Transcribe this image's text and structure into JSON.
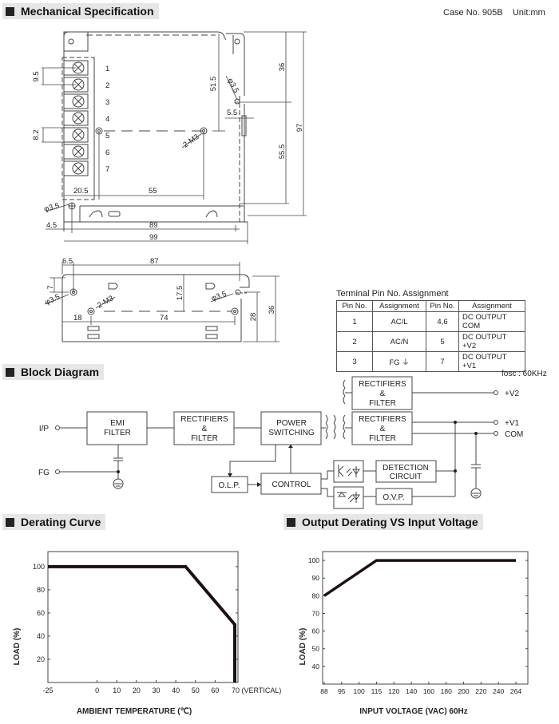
{
  "sections": {
    "mechanical": "Mechanical Specification",
    "block": "Block Diagram",
    "derating": "Derating Curve",
    "output_derating": "Output Derating VS Input Voltage"
  },
  "case_info": "Case No. 905B    Unit:mm",
  "mechanical": {
    "pin_numbers": [
      "1",
      "2",
      "3",
      "4",
      "5",
      "6",
      "7"
    ],
    "dims_top": {
      "d9_5": "9.5",
      "d8_2": "8.2",
      "d51_5": "51.5",
      "d3_5": "φ3.5",
      "d5_5": "5.5",
      "d36": "36",
      "d55_5": "55.5",
      "d97": "97",
      "m3": "2-M3",
      "d20_5": "20.5",
      "d55": "55",
      "d3_5b": "φ3.5",
      "d4_5": "4.5",
      "d89": "89",
      "d99": "99"
    },
    "dims_side": {
      "d6_5": "6.5",
      "d87": "87",
      "d7": "7",
      "d3_5": "φ3.5",
      "m3": "2-M3",
      "d17_5": "17.5",
      "d3_5r": "φ3.5",
      "d18": "18",
      "d74": "74",
      "d28": "28",
      "d36": "36"
    }
  },
  "pin_table": {
    "title": "Terminal Pin No.  Assignment",
    "headers": [
      "Pin No.",
      "Assignment",
      "Pin No.",
      "Assignment"
    ],
    "rows": [
      [
        "1",
        "AC/L",
        "4,6",
        "DC OUTPUT COM"
      ],
      [
        "2",
        "AC/N",
        "5",
        "DC OUTPUT +V2"
      ],
      [
        "3",
        "FG ⏚",
        "7",
        "DC OUTPUT +V1"
      ]
    ]
  },
  "block_diagram": {
    "fosc": "fosc : 60KHz",
    "ip": "I/P",
    "fg": "FG",
    "emi1": "EMI",
    "emi2": "FILTER",
    "rect_a1": "RECTIFIERS",
    "rect_a2": "&",
    "rect_a3": "FILTER",
    "pwr1": "POWER",
    "pwr2": "SWITCHING",
    "rect_b1": "RECTIFIERS",
    "rect_b2": "&",
    "rect_b3": "FILTER",
    "rect_c1": "RECTIFIERS",
    "rect_c2": "&",
    "rect_c3": "FILTER",
    "v2": "+V2",
    "v1": "+V1",
    "com": "COM",
    "olp": "O.L.P.",
    "control": "CONTROL",
    "det1": "DETECTION",
    "det2": "CIRCUIT",
    "ovp": "O.V.P."
  },
  "chart_data": [
    {
      "type": "line",
      "title": "Derating Curve",
      "xlabel": "AMBIENT TEMPERATURE (℃)",
      "ylabel": "LOAD (%)",
      "x_ticks": [
        "-25",
        "0",
        "10",
        "20",
        "30",
        "40",
        "50",
        "60",
        "70 (VERTICAL)"
      ],
      "y_ticks": [
        "20",
        "40",
        "60",
        "80",
        "100"
      ],
      "xlim": [
        -25,
        70
      ],
      "ylim": [
        0,
        113
      ],
      "series": [
        {
          "name": "Load",
          "x": [
            -25,
            45,
            70,
            70
          ],
          "y": [
            100,
            100,
            50,
            0
          ]
        }
      ]
    },
    {
      "type": "line",
      "title": "Output Derating VS Input Voltage",
      "xlabel": "INPUT VOLTAGE (VAC) 60Hz",
      "ylabel": "LOAD (%)",
      "x_ticks": [
        "88",
        "95",
        "100",
        "115",
        "120",
        "140",
        "160",
        "180",
        "200",
        "220",
        "240",
        "264"
      ],
      "y_ticks": [
        "40",
        "50",
        "60",
        "70",
        "80",
        "90",
        "100"
      ],
      "ylim": [
        30,
        105
      ],
      "series": [
        {
          "name": "Load",
          "x": [
            "88",
            "115",
            "264"
          ],
          "y": [
            80,
            100,
            100
          ]
        }
      ]
    }
  ]
}
